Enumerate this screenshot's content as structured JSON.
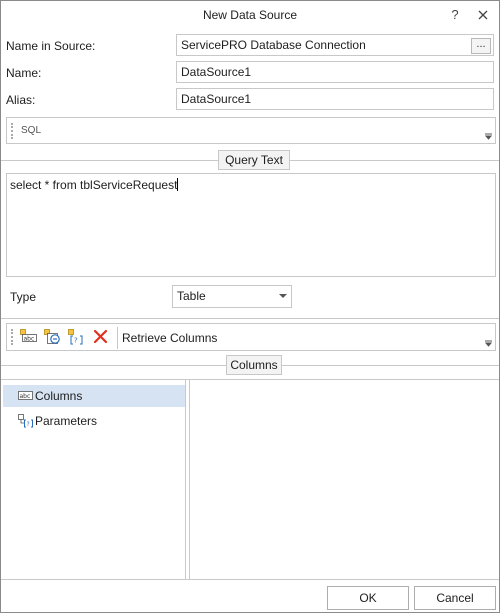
{
  "window": {
    "title": "New Data Source",
    "help_label": "?",
    "close_label": "✕"
  },
  "form": {
    "name_in_source_label": "Name in Source:",
    "name_in_source_value": "ServicePRO Database Connection",
    "browse_label": "...",
    "name_label": "Name:",
    "name_value": "DataSource1",
    "alias_label": "Alias:",
    "alias_value": "DataSource1"
  },
  "sql_toolbar": {
    "label": "SQL"
  },
  "query_section": {
    "label": "Query Text",
    "text": "select * from tblServiceRequest"
  },
  "type_row": {
    "label": "Type",
    "selected": "Table"
  },
  "columns_toolbar": {
    "retrieve_label": "Retrieve Columns",
    "icons": [
      "add-column-icon",
      "add-expression-icon",
      "add-parameter-icon",
      "delete-icon"
    ]
  },
  "columns_section": {
    "label": "Columns"
  },
  "tree": {
    "items": [
      {
        "label": "Columns",
        "icon": "columns-icon",
        "selected": true
      },
      {
        "label": "Parameters",
        "icon": "parameters-icon",
        "selected": false
      }
    ]
  },
  "footer": {
    "ok_label": "OK",
    "cancel_label": "Cancel"
  },
  "colors": {
    "selection": "#d6e3f3",
    "delete_red": "#e0301e",
    "border": "#c8c8c8"
  }
}
